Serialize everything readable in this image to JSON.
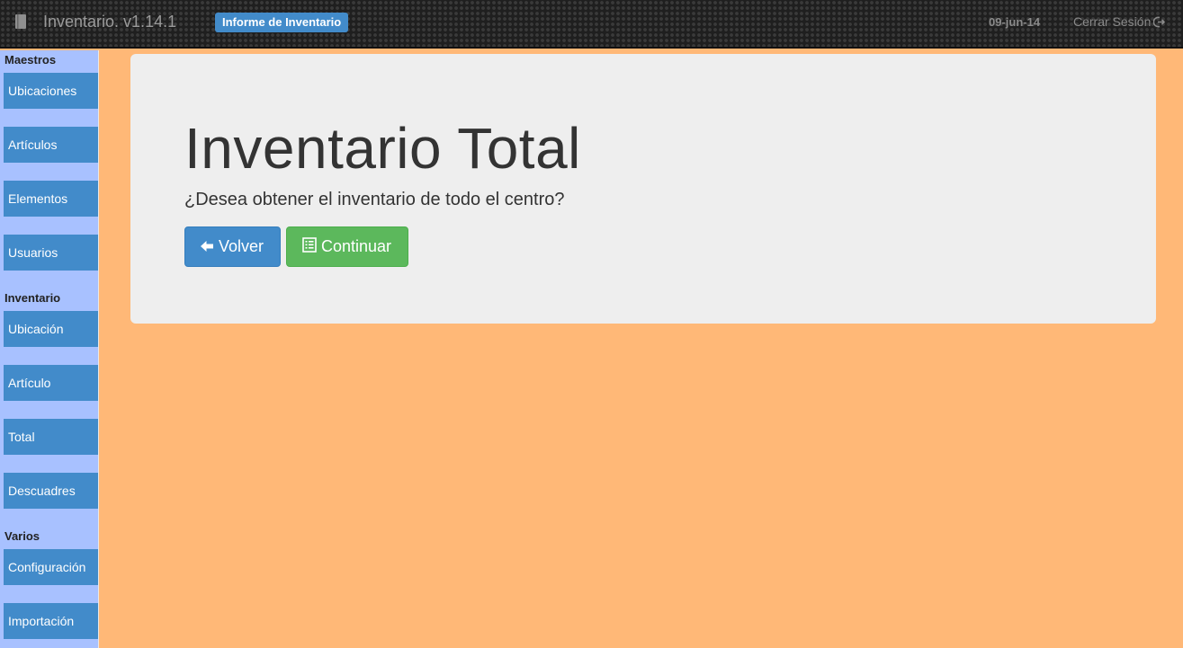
{
  "navbar": {
    "brand_icon": "book-icon",
    "title": "Inventario. v1.14.1",
    "report_badge": "Informe de Inventario",
    "date": "09-jun-14",
    "logout_label": "Cerrar Sesión",
    "logout_icon": "sign-out-icon"
  },
  "sidebar": {
    "sections": [
      {
        "heading": "Maestros",
        "items": [
          "Ubicaciones",
          "Artículos",
          "Elementos",
          "Usuarios"
        ]
      },
      {
        "heading": "Inventario",
        "items": [
          "Ubicación",
          "Artículo",
          "Total",
          "Descuadres"
        ]
      },
      {
        "heading": "Varios",
        "items": [
          "Configuración",
          "Importación"
        ]
      }
    ]
  },
  "main": {
    "title": "Inventario Total",
    "question": "¿Desea obtener el inventario de todo el centro?",
    "back_label": "Volver",
    "back_icon": "arrow-left-icon",
    "continue_label": "Continuar",
    "continue_icon": "list-alt-icon"
  },
  "colors": {
    "page_background": "#ffb877",
    "sidebar_background": "#a8c1ff",
    "primary": "#428bca",
    "success": "#5cb85c",
    "jumbotron": "#eeeeee"
  }
}
